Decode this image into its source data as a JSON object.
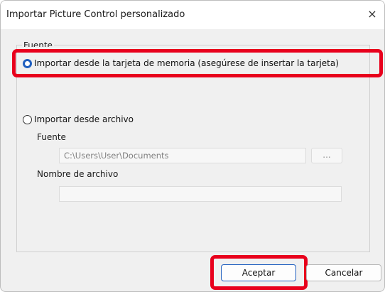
{
  "window": {
    "title": "Importar Picture Control personalizado",
    "close_glyph": "×"
  },
  "group": {
    "legend": "Fuente"
  },
  "options": {
    "memory_card": {
      "label": "Importar desde la tarjeta de memoria (asegúrese de insertar la tarjeta)",
      "checked": true
    },
    "from_file": {
      "label": "Importar desde archivo",
      "checked": false
    }
  },
  "fields": {
    "source_label": "Fuente",
    "source_value": "C:\\Users\\User\\Documents",
    "browse_label": "...",
    "filename_label": "Nombre de archivo",
    "filename_value": ""
  },
  "buttons": {
    "accept": "Aceptar",
    "cancel": "Cancelar"
  },
  "colors": {
    "highlight": "#e8001c",
    "radio_accent": "#1f5fbf"
  }
}
